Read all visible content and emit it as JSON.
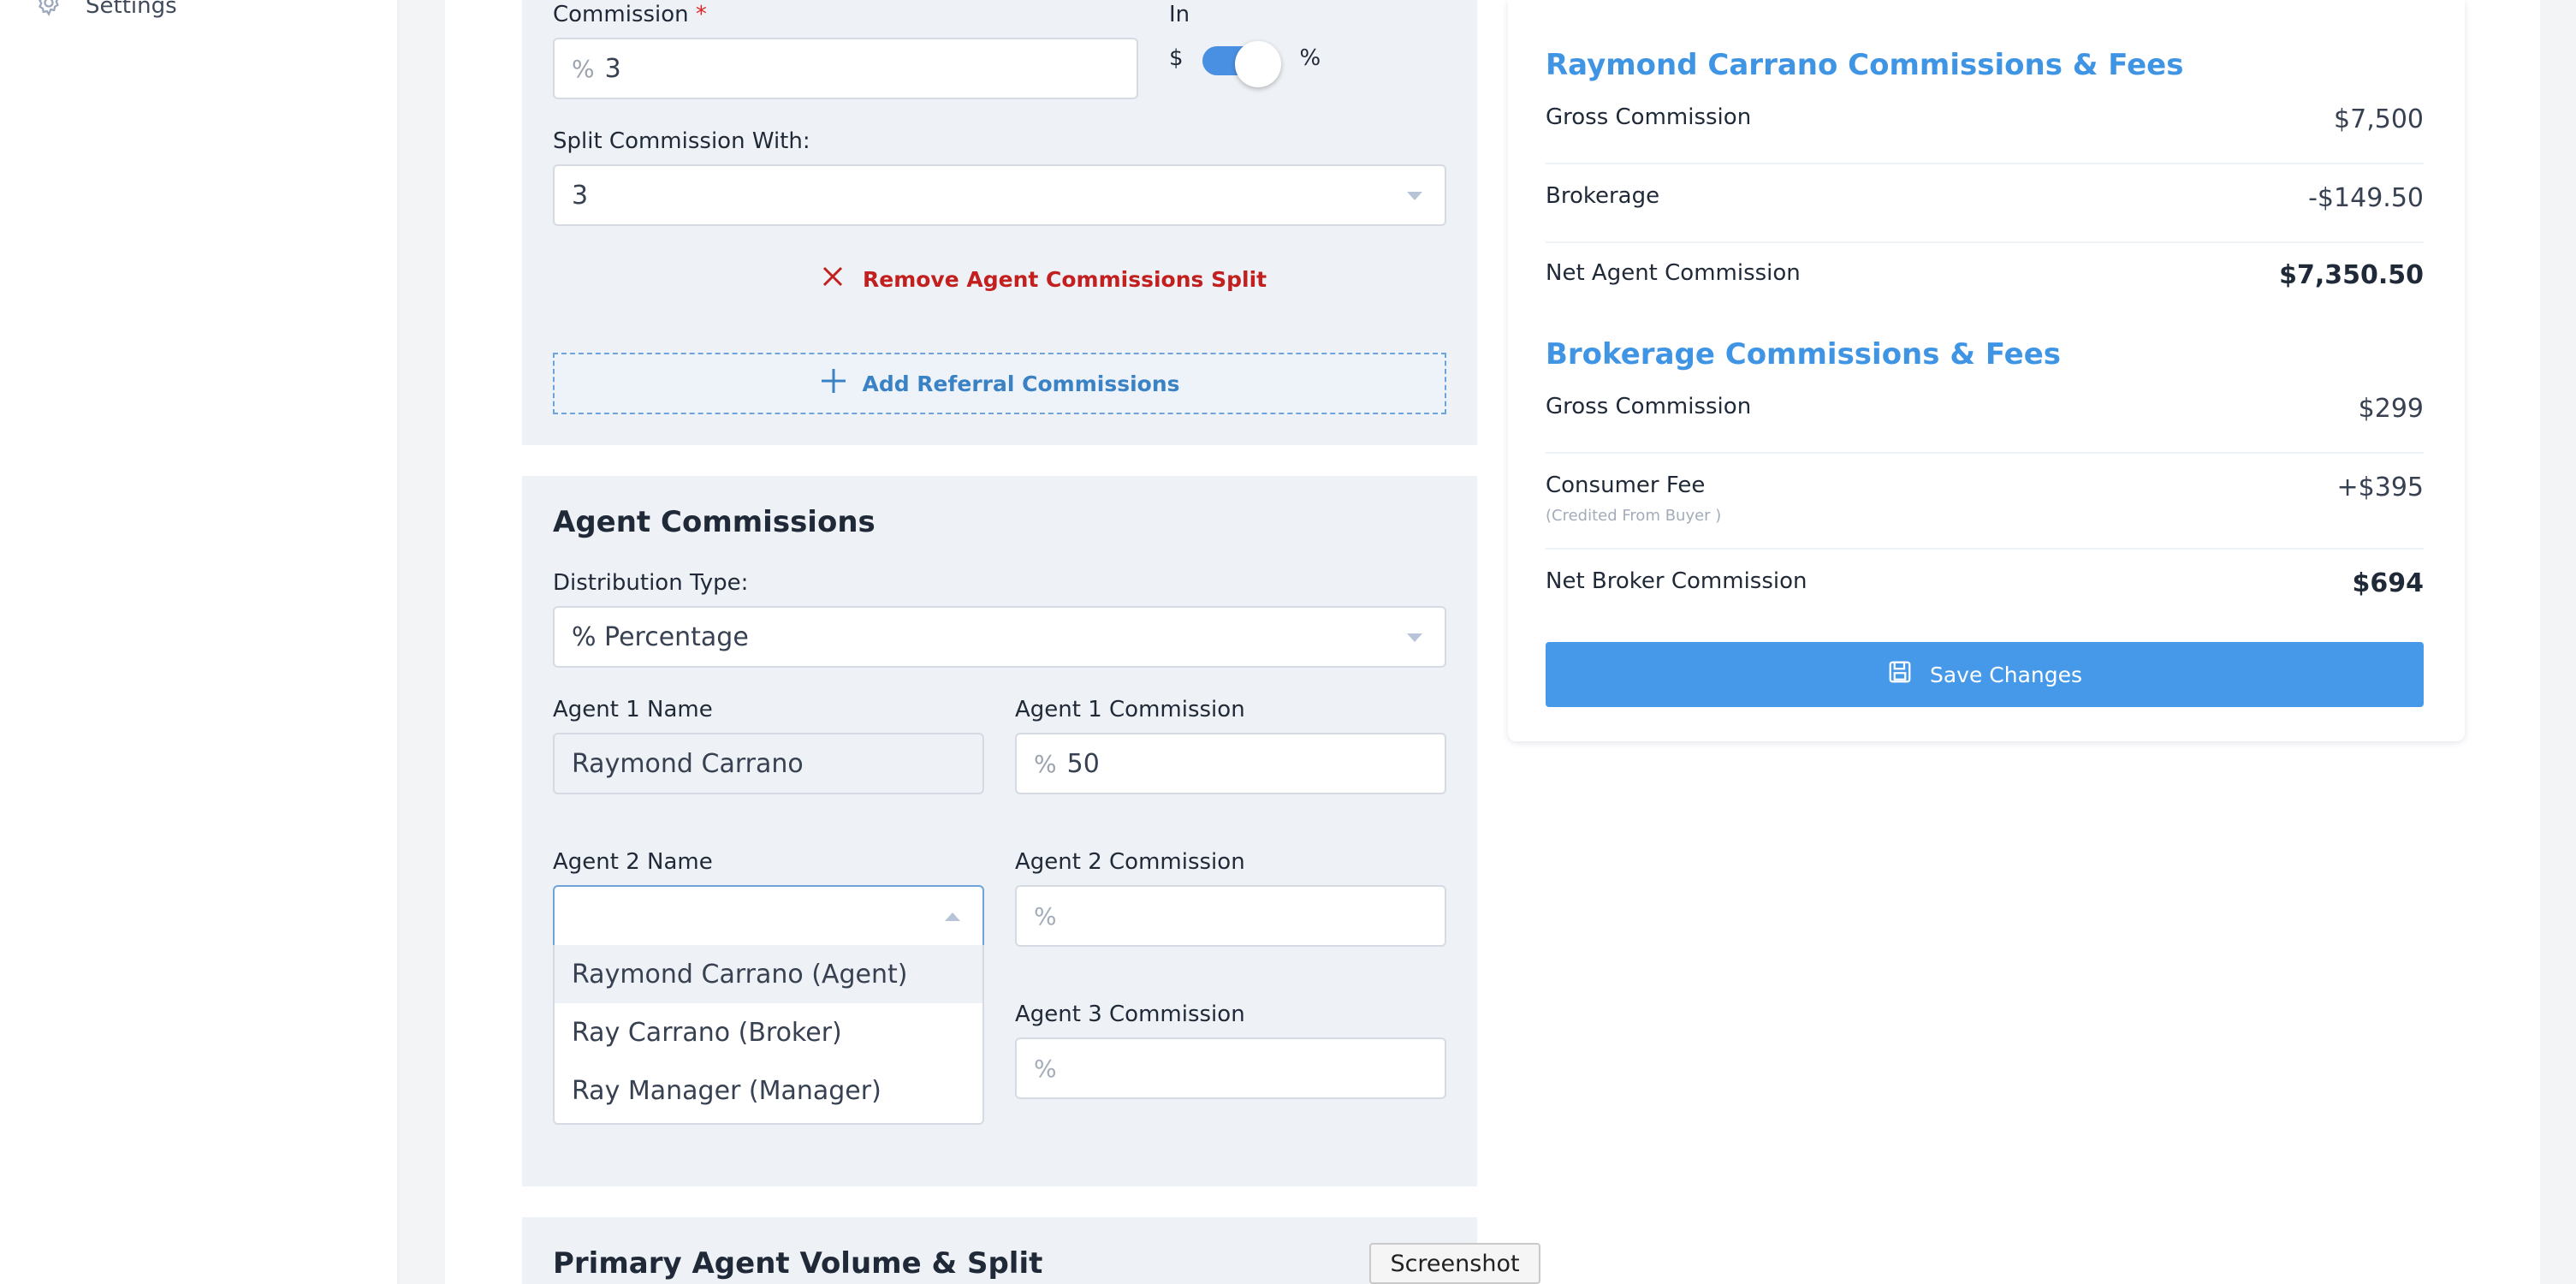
{
  "sidebar": {
    "settings_label": "Settings"
  },
  "commission": {
    "label": "Commission",
    "required_mark": "*",
    "prefix": "%",
    "value": "3",
    "in_label": "In",
    "toggle_left": "$",
    "toggle_right": "%"
  },
  "split": {
    "label": "Split Commission With:",
    "value": "3",
    "remove_label": "Remove Agent Commissions Split",
    "add_referral_label": "Add Referral Commissions"
  },
  "agent_commissions": {
    "title": "Agent Commissions",
    "distribution_label": "Distribution Type:",
    "distribution_value": "% Percentage",
    "agent1_name_label": "Agent 1 Name",
    "agent1_name_value": "Raymond Carrano",
    "agent1_commission_label": "Agent 1 Commission",
    "agent1_commission_prefix": "%",
    "agent1_commission_value": "50",
    "agent2_name_label": "Agent 2 Name",
    "agent2_commission_label": "Agent 2 Commission",
    "agent2_commission_placeholder": "%",
    "agent3_commission_label": "Agent 3 Commission",
    "agent3_commission_placeholder": "%",
    "dropdown_options": [
      "Raymond Carrano (Agent)",
      "Ray Carrano (Broker)",
      "Ray Manager (Manager)"
    ]
  },
  "primary_agent": {
    "title": "Primary Agent Volume & Split"
  },
  "summary": {
    "agent_title": "Raymond Carrano Commissions & Fees",
    "agent_rows": [
      {
        "label": "Gross Commission",
        "value": "$7,500"
      },
      {
        "label": "Brokerage",
        "value": "-$149.50"
      },
      {
        "label": "Net Agent Commission",
        "value": "$7,350.50"
      }
    ],
    "broker_title": "Brokerage Commissions & Fees",
    "broker_rows": [
      {
        "label": "Gross Commission",
        "value": "$299"
      },
      {
        "label": "Consumer Fee",
        "sub": "(Credited From Buyer )",
        "value": "+$395"
      },
      {
        "label": "Net Broker Commission",
        "value": "$694"
      }
    ],
    "save_label": "Save Changes"
  },
  "overlay": {
    "screenshot_label": "Screenshot"
  },
  "colors": {
    "accent": "#4599e8",
    "title_blue": "#3f95e4",
    "danger": "#c21f1f",
    "panel_bg": "#eef1f5"
  }
}
